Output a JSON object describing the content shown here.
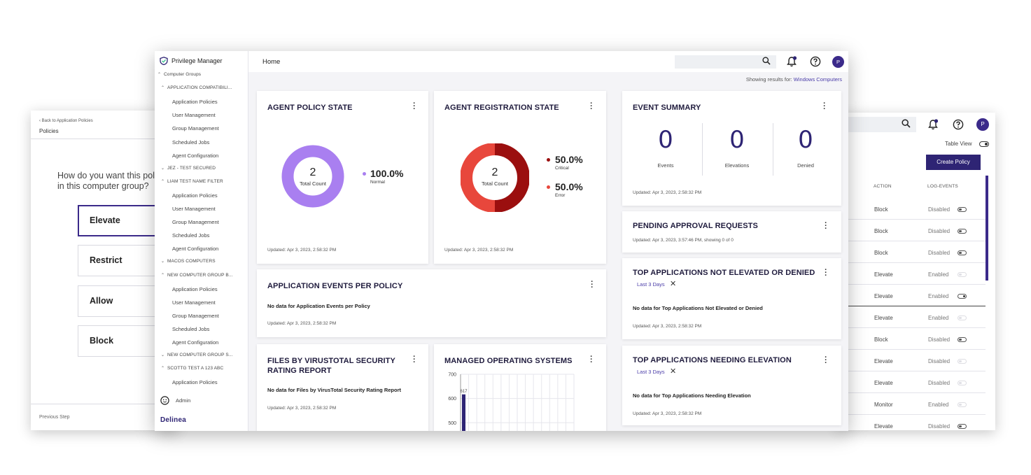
{
  "left_window": {
    "back_link": "Back to Application Policies",
    "title": "Policies",
    "question_line1": "How do you want this polic",
    "question_line2": "in this computer group?",
    "options": [
      "Elevate",
      "Restrict",
      "Allow",
      "Block"
    ],
    "selected": "Elevate",
    "previous_step": "Previous Step"
  },
  "right_window": {
    "table_view_label": "Table View",
    "create_policy": "Create Policy",
    "columns": [
      "ACTION",
      "LOG-EVENTS"
    ],
    "rows": [
      {
        "action": "Block",
        "log": "Disabled",
        "toggle": "off-dark"
      },
      {
        "action": "Block",
        "log": "Disabled",
        "toggle": "off-dark"
      },
      {
        "action": "Block",
        "log": "Disabled",
        "toggle": "off-dark"
      },
      {
        "action": "Elevate",
        "log": "Enabled",
        "toggle": "off-light"
      },
      {
        "action": "Elevate",
        "log": "Enabled",
        "toggle": "on"
      },
      {
        "action": "Elevate",
        "log": "Enabled",
        "toggle": "off-light"
      },
      {
        "action": "Block",
        "log": "Disabled",
        "toggle": "off-dark"
      },
      {
        "action": "Elevate",
        "log": "Disabled",
        "toggle": "off-light"
      },
      {
        "action": "Elevate",
        "log": "Disabled",
        "toggle": "off-light"
      },
      {
        "action": "Monitor",
        "log": "Enabled",
        "toggle": "off-light"
      },
      {
        "action": "Elevate",
        "log": "Disabled",
        "toggle": "off-dark"
      }
    ],
    "avatar": "P"
  },
  "main": {
    "app_name": "Privilege Manager",
    "breadcrumb": "Home",
    "avatar": "P",
    "showing_prefix": "Showing results for:",
    "showing_target": "Windows Computers",
    "sidebar": [
      {
        "label": "Computer Groups",
        "kind": "group",
        "caret": "^"
      },
      {
        "label": "APPLICATION COMPATIBILI...",
        "kind": "subgroup",
        "caret": "^"
      },
      {
        "label": "Application Policies",
        "kind": "item"
      },
      {
        "label": "User Management",
        "kind": "item"
      },
      {
        "label": "Group Management",
        "kind": "item"
      },
      {
        "label": "Scheduled Jobs",
        "kind": "item"
      },
      {
        "label": "Agent Configuration",
        "kind": "item"
      },
      {
        "label": "JEZ - TEST SECURED",
        "kind": "subgroup",
        "caret": "v"
      },
      {
        "label": "LIAM TEST NAME FILTER",
        "kind": "subgroup",
        "caret": "^"
      },
      {
        "label": "Application Policies",
        "kind": "item"
      },
      {
        "label": "User Management",
        "kind": "item"
      },
      {
        "label": "Group Management",
        "kind": "item"
      },
      {
        "label": "Scheduled Jobs",
        "kind": "item"
      },
      {
        "label": "Agent Configuration",
        "kind": "item"
      },
      {
        "label": "MACOS COMPUTERS",
        "kind": "subgroup",
        "caret": "v"
      },
      {
        "label": "NEW COMPUTER GROUP B...",
        "kind": "subgroup",
        "caret": "^"
      },
      {
        "label": "Application Policies",
        "kind": "item"
      },
      {
        "label": "User Management",
        "kind": "item"
      },
      {
        "label": "Group Management",
        "kind": "item"
      },
      {
        "label": "Scheduled Jobs",
        "kind": "item"
      },
      {
        "label": "Agent Configuration",
        "kind": "item"
      },
      {
        "label": "NEW COMPUTER GROUP S...",
        "kind": "subgroup",
        "caret": "v"
      },
      {
        "label": "SCOTTG TEST A 123 ABC",
        "kind": "subgroup",
        "caret": "^"
      },
      {
        "label": "Application Policies",
        "kind": "item"
      }
    ],
    "admin_label": "Admin",
    "logo_text": "Delinea",
    "cards": {
      "agent_policy": {
        "title": "AGENT POLICY STATE",
        "center_value": "2",
        "center_label": "Total Count",
        "legend": [
          {
            "value": "100.0%",
            "label": "Normal",
            "color": "#a97ff0"
          }
        ],
        "updated": "Updated: Apr 3, 2023, 2:58:32 PM"
      },
      "agent_registration": {
        "title": "AGENT REGISTRATION STATE",
        "center_value": "2",
        "center_label": "Total Count",
        "legend": [
          {
            "value": "50.0%",
            "label": "Critical",
            "color": "#9b0f0f"
          },
          {
            "value": "50.0%",
            "label": "Error",
            "color": "#e8473c"
          }
        ],
        "updated": "Updated: Apr 3, 2023, 2:58:32 PM"
      },
      "event_summary": {
        "title": "EVENT SUMMARY",
        "stats": [
          {
            "value": "0",
            "label": "Events"
          },
          {
            "value": "0",
            "label": "Elevations"
          },
          {
            "value": "0",
            "label": "Denied"
          }
        ],
        "updated": "Updated: Apr 3, 2023, 2:58:32 PM"
      },
      "pending": {
        "title": "PENDING APPROVAL REQUESTS",
        "updated": "Updated: Apr 3, 2023, 3:57:46 PM, showing 0 of 0"
      },
      "top_not_elevated": {
        "title": "TOP APPLICATIONS NOT ELEVATED OR DENIED",
        "chip": "Last 3 Days",
        "nodata": "No data for Top Applications Not Elevated or Denied",
        "updated": "Updated: Apr 3, 2023, 2:58:32 PM"
      },
      "app_events": {
        "title": "APPLICATION EVENTS PER POLICY",
        "nodata": "No data for Application Events per Policy",
        "updated": "Updated: Apr 3, 2023, 2:58:32 PM"
      },
      "files_vt": {
        "title_line1": "FILES BY VIRUSTOTAL SECURITY",
        "title_line2": "RATING REPORT",
        "nodata": "No data for Files by VirusTotal Security Rating Report",
        "updated": "Updated: Apr 3, 2023, 2:58:32 PM"
      },
      "managed_os": {
        "title": "MANAGED OPERATING SYSTEMS"
      },
      "top_needing": {
        "title": "TOP APPLICATIONS NEEDING ELEVATION",
        "chip": "Last 3 Days",
        "nodata": "No data for Top Applications Needing Elevation",
        "updated": "Updated: Apr 3, 2023, 2:58:32 PM"
      }
    }
  },
  "chart_data": {
    "type": "bar",
    "title": "MANAGED OPERATING SYSTEMS",
    "yticks": [
      700,
      600,
      500
    ],
    "ylim": [
      420,
      700
    ],
    "values": [
      617
    ],
    "data_labels": [
      "617"
    ],
    "color": "#2e2474",
    "grid": true
  }
}
